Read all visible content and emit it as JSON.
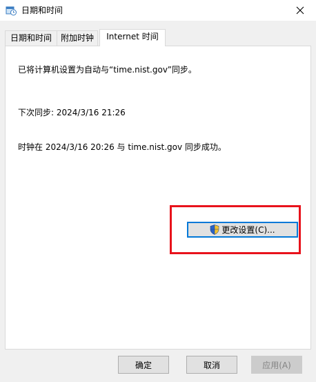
{
  "window": {
    "title": "日期和时间",
    "icon": "date-time-icon",
    "close_glyph": "✕"
  },
  "tabs": [
    {
      "label": "日期和时间",
      "active": false
    },
    {
      "label": "附加时钟",
      "active": false
    },
    {
      "label": "Internet 时间",
      "active": true
    }
  ],
  "panel": {
    "sync_setting": "已将计算机设置为自动与“time.nist.gov”同步。",
    "next_sync": "下次同步: 2024/3/16 21:26",
    "last_sync": "时钟在 2024/3/16 20:26 与 time.nist.gov 同步成功。",
    "change_button": "更改设置(C)..."
  },
  "buttons": {
    "ok": "确定",
    "cancel": "取消",
    "apply": "应用(A)"
  },
  "colors": {
    "highlight": "#e8121b",
    "focus_border": "#0078d7",
    "panel_bg": "#ffffff",
    "window_bg": "#f0f0f0"
  }
}
